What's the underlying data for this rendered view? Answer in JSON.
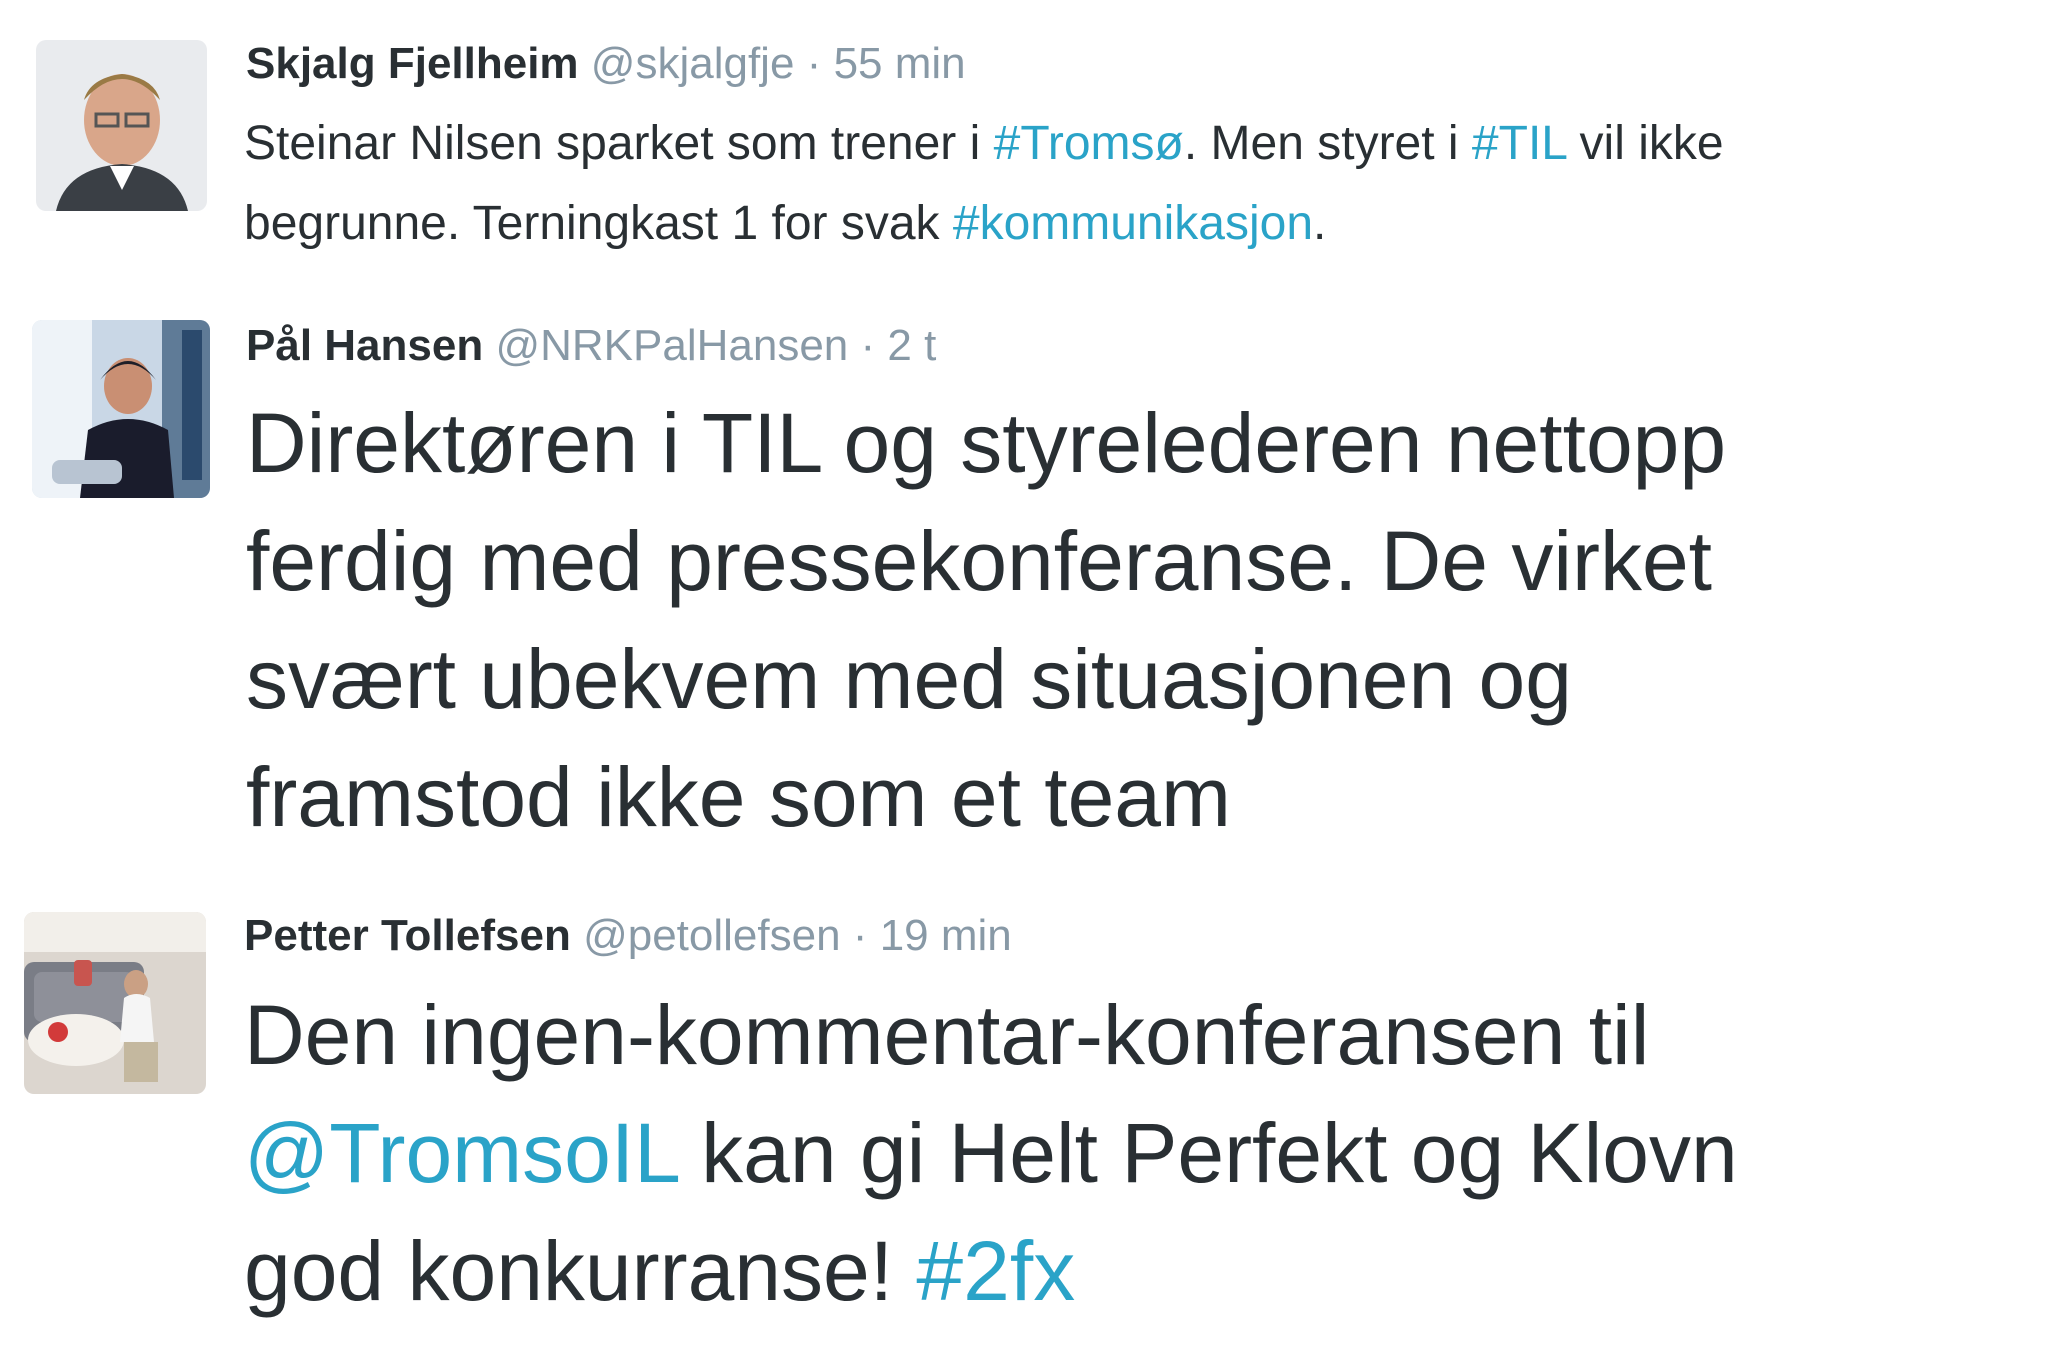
{
  "tweets": [
    {
      "name": "Skjalg Fjellheim",
      "handle": "@skjalgfje",
      "separator": "·",
      "time": "55 min",
      "avatar_icon": "user-avatar-icon",
      "lines": [
        [
          {
            "text": "Steinar Nilsen sparket som trener i ",
            "link": false
          },
          {
            "text": "#Tromsø",
            "link": true
          },
          {
            "text": ". Men styret i ",
            "link": false
          },
          {
            "text": "#TIL",
            "link": true
          },
          {
            "text": " vil ikke",
            "link": false
          }
        ],
        [
          {
            "text": "begrunne. Terningkast 1 for svak ",
            "link": false
          },
          {
            "text": "#kommunikasjon",
            "link": true
          },
          {
            "text": ".",
            "link": false
          }
        ]
      ]
    },
    {
      "name": "Pål Hansen",
      "handle": "@NRKPalHansen",
      "separator": "·",
      "time": "2 t",
      "avatar_icon": "user-avatar-icon",
      "lines": [
        [
          {
            "text": "Direktøren i TIL og styrelederen nettopp",
            "link": false
          }
        ],
        [
          {
            "text": "ferdig med pressekonferanse.  De virket",
            "link": false
          }
        ],
        [
          {
            "text": "svært ubekvem med situasjonen og",
            "link": false
          }
        ],
        [
          {
            "text": "framstod ikke som et team",
            "link": false
          }
        ]
      ]
    },
    {
      "name": "Petter Tollefsen",
      "handle": "@petollefsen",
      "separator": "·",
      "time": "19 min",
      "avatar_icon": "user-avatar-icon",
      "lines": [
        [
          {
            "text": "Den ingen-kommentar-konferansen til",
            "link": false
          }
        ],
        [
          {
            "text": "@TromsoIL",
            "link": true
          },
          {
            "text": " kan gi Helt Perfekt og Klovn",
            "link": false
          }
        ],
        [
          {
            "text": "god konkurranse! ",
            "link": false
          },
          {
            "text": "#2fx",
            "link": true
          }
        ]
      ]
    }
  ],
  "colors": {
    "text": "#292f33",
    "meta": "#8899a6",
    "link": "#2aa3c8",
    "background": "#ffffff"
  }
}
